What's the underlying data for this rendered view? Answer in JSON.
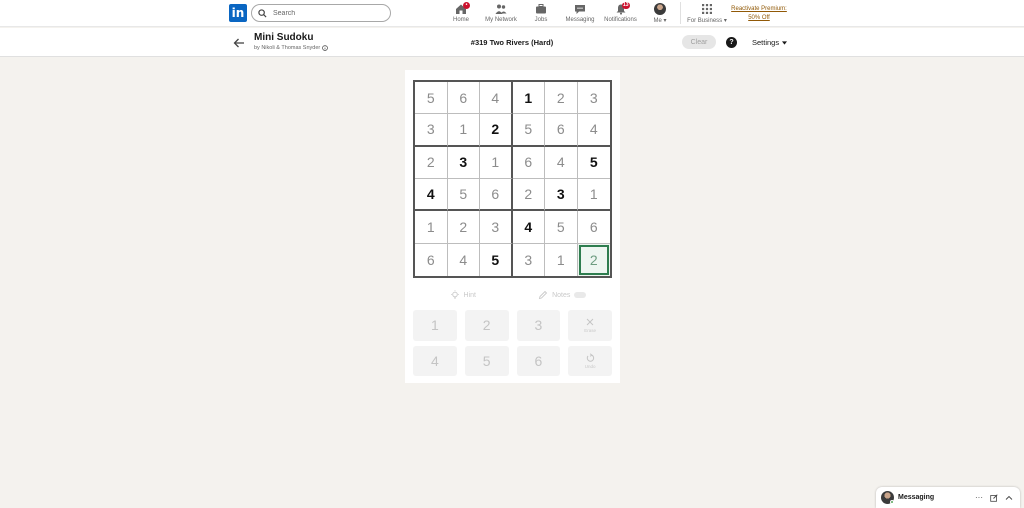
{
  "nav": {
    "logo_text": "in",
    "search_placeholder": "Search",
    "items": [
      {
        "label": "Home",
        "badge": "•"
      },
      {
        "label": "My Network"
      },
      {
        "label": "Jobs"
      },
      {
        "label": "Messaging"
      },
      {
        "label": "Notifications",
        "badge": "13"
      },
      {
        "label": "Me ▾"
      },
      {
        "label": "For Business ▾"
      }
    ],
    "premium": {
      "line1": "Reactivate Premium:",
      "line2": "50% Off"
    }
  },
  "header": {
    "title": "Mini Sudoku",
    "byline": "by Nikoli & Thomas Snyder",
    "puzzle": "#319 Two Rivers (Hard)",
    "clear_label": "Clear",
    "help_label": "?",
    "settings_label": "Settings"
  },
  "board": {
    "rows": [
      [
        "5",
        "6",
        "4",
        "1",
        "2",
        "3"
      ],
      [
        "3",
        "1",
        "2",
        "5",
        "6",
        "4"
      ],
      [
        "2",
        "3",
        "1",
        "6",
        "4",
        "5"
      ],
      [
        "4",
        "5",
        "6",
        "2",
        "3",
        "1"
      ],
      [
        "1",
        "2",
        "3",
        "4",
        "5",
        "6"
      ],
      [
        "6",
        "4",
        "5",
        "3",
        "1",
        "2"
      ]
    ],
    "givens": [
      [
        false,
        false,
        false,
        true,
        false,
        false
      ],
      [
        false,
        false,
        true,
        false,
        false,
        false
      ],
      [
        false,
        true,
        false,
        false,
        false,
        true
      ],
      [
        true,
        false,
        false,
        false,
        true,
        false
      ],
      [
        false,
        false,
        false,
        true,
        false,
        false
      ],
      [
        false,
        false,
        true,
        false,
        false,
        false
      ]
    ],
    "selected": [
      5,
      5
    ]
  },
  "tools": {
    "hint_label": "Hint",
    "notes_label": "Notes"
  },
  "keypad": {
    "row1": [
      "1",
      "2",
      "3"
    ],
    "row2": [
      "4",
      "5",
      "6"
    ],
    "erase_label": "Erase",
    "undo_label": "Undo"
  },
  "messaging": {
    "label": "Messaging",
    "more": "···"
  },
  "colors": {
    "brand": "#0a66c2",
    "badge": "#cb112d",
    "selected_outline": "#2e7d4f",
    "premium": "#915907"
  }
}
